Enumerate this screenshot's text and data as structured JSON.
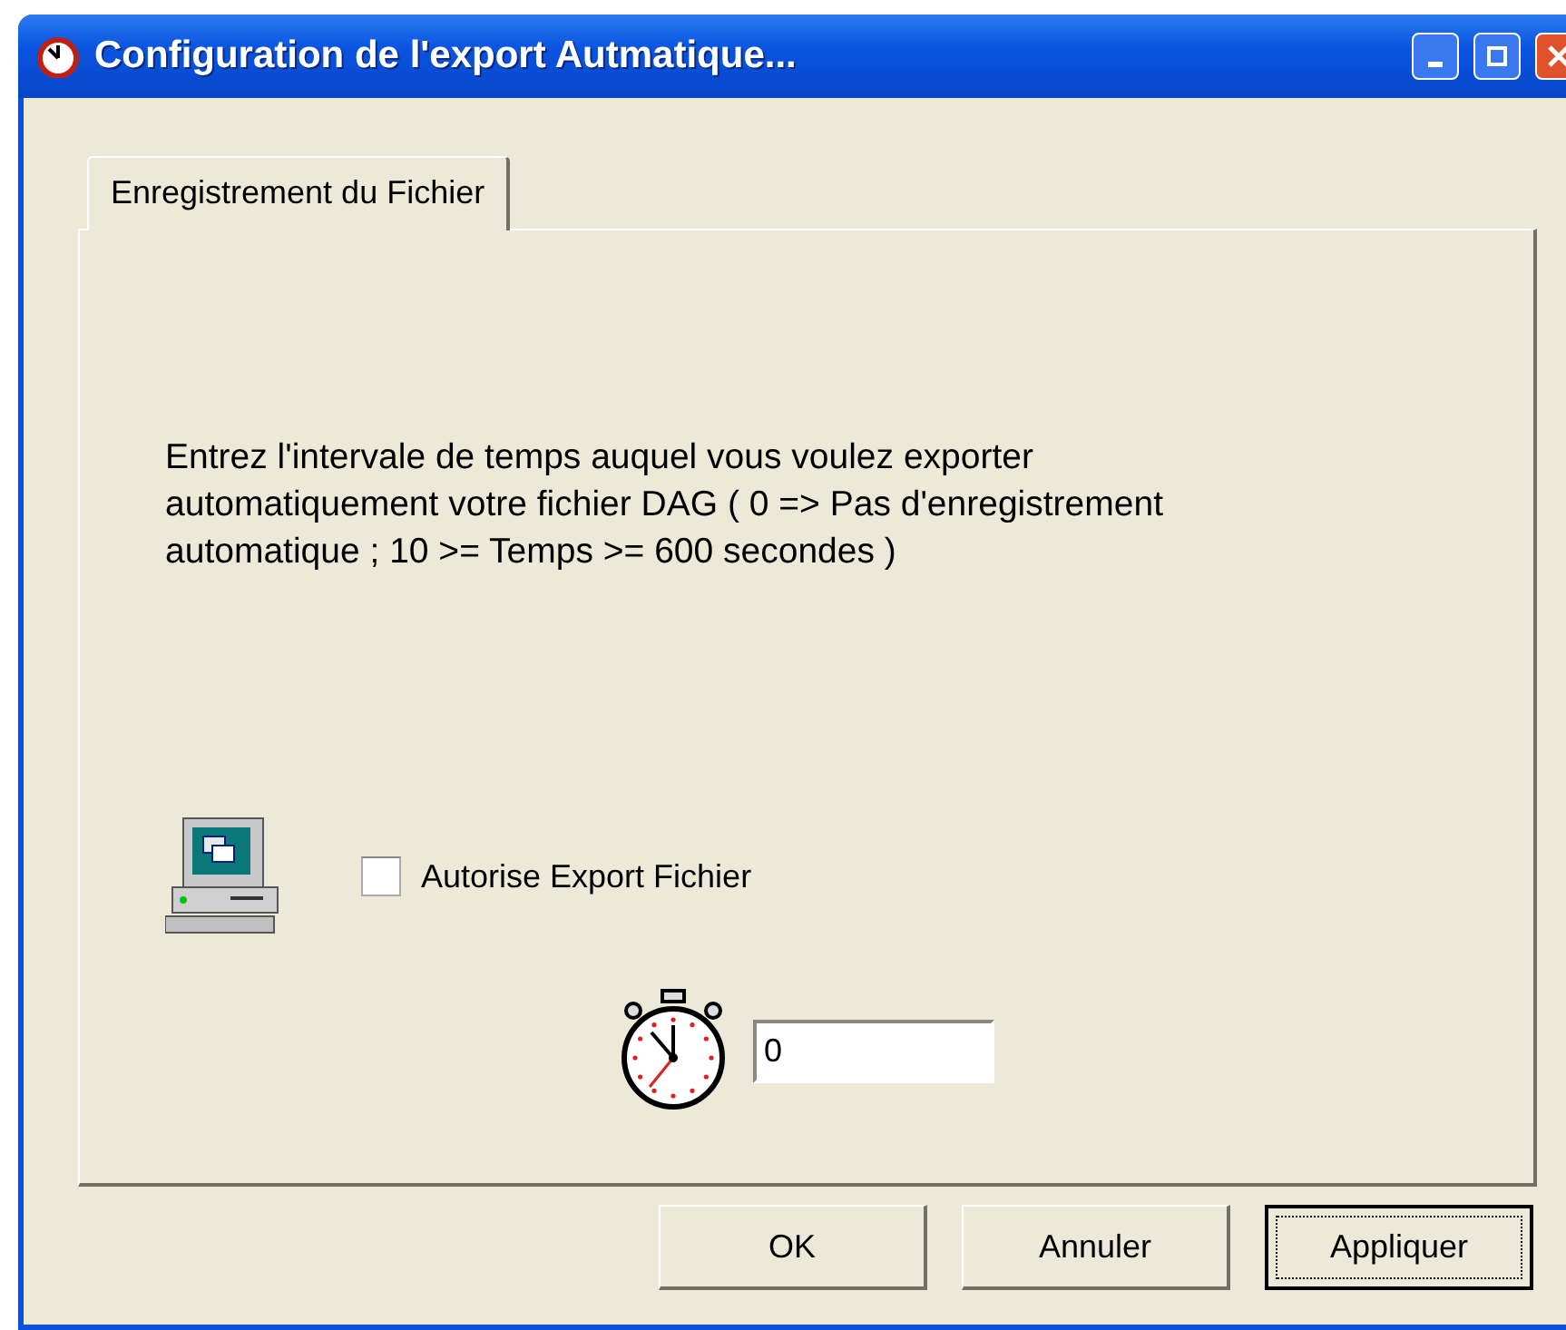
{
  "window": {
    "title": "Configuration de l'export Autmatique..."
  },
  "tabs": [
    {
      "label": "Enregistrement du Fichier",
      "selected": true
    }
  ],
  "description": "Entrez l'intervale de temps auquel vous voulez exporter automatiquement votre fichier DAG ( 0 => Pas d'enregistrement automatique ; 10 >= Temps >= 600 secondes )",
  "export_checkbox": {
    "label": "Autorise Export Fichier",
    "checked": false
  },
  "interval_field": {
    "value": "0"
  },
  "buttons": [
    {
      "label": "OK",
      "focused": false
    },
    {
      "label": "Annuler",
      "focused": false
    },
    {
      "label": "Appliquer",
      "focused": true
    }
  ]
}
